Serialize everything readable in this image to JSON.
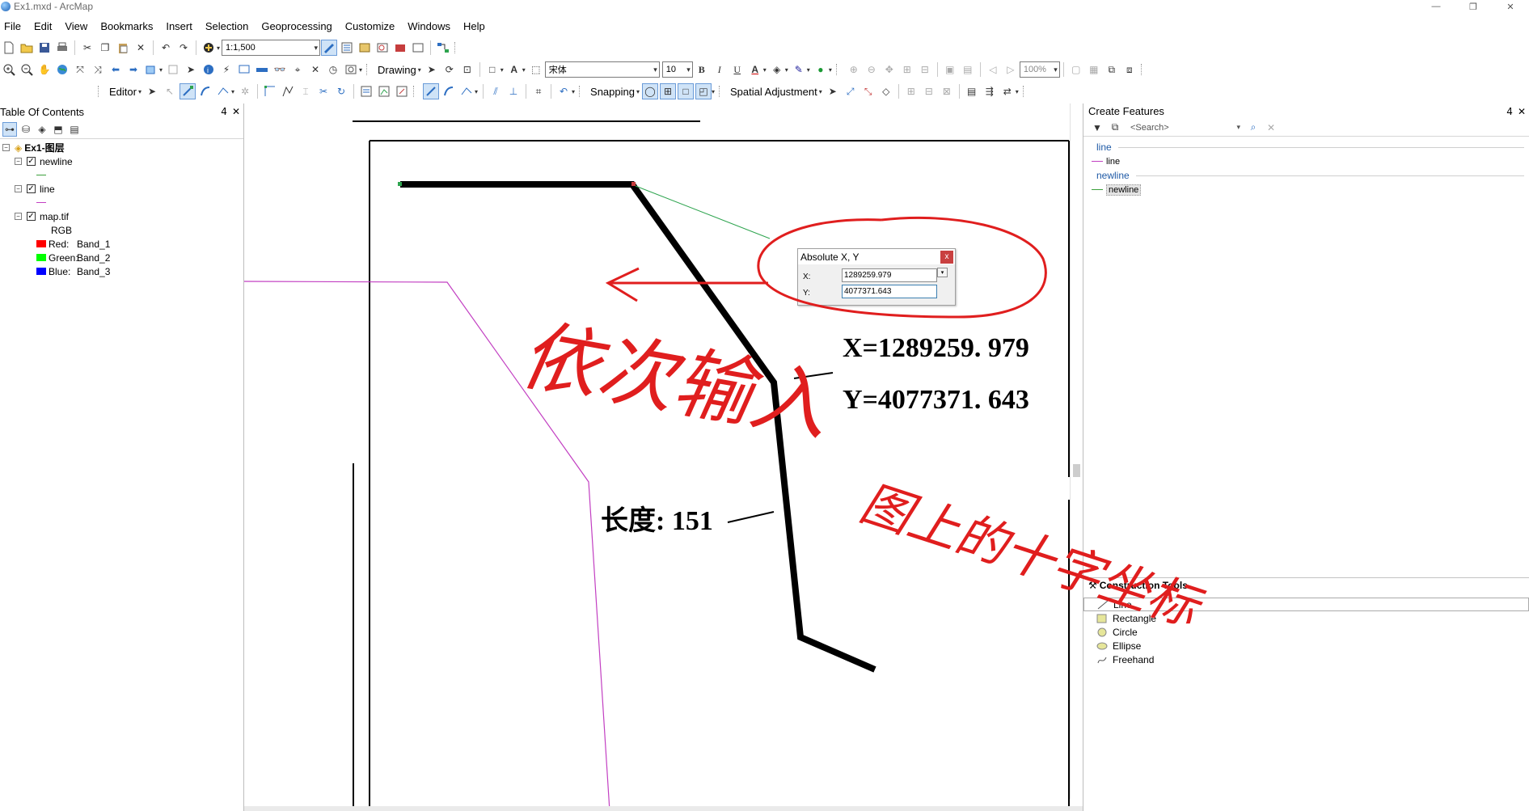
{
  "window": {
    "title": "Ex1.mxd - ArcMap",
    "controls": [
      "—",
      "❐",
      "✕"
    ]
  },
  "menu": [
    "File",
    "Edit",
    "View",
    "Bookmarks",
    "Insert",
    "Selection",
    "Geoprocessing",
    "Customize",
    "Windows",
    "Help"
  ],
  "toolbar": {
    "scale": "1:1,500",
    "drawing_label": "Drawing",
    "font_name": "宋体",
    "font_size": "10",
    "bold": "B",
    "italic": "I",
    "underline": "U",
    "text_color_letter": "A",
    "zoom_percent": "100%",
    "editor_label": "Editor",
    "snapping_label": "Snapping",
    "spatial_adjustment_label": "Spatial Adjustment"
  },
  "toc": {
    "title": "Table Of Contents",
    "pin": "4",
    "close": "✕",
    "root": "Ex1-图层",
    "layers": [
      {
        "name": "newline",
        "checked": true,
        "symbol_color": "#3ca03c"
      },
      {
        "name": "line",
        "checked": true,
        "symbol_color": "#c23fc2"
      },
      {
        "name": "map.tif",
        "checked": true
      }
    ],
    "raster": {
      "composite": "RGB",
      "bands": [
        {
          "channel": "Red:",
          "band": "Band_1",
          "color": "#ff0000"
        },
        {
          "channel": "Green:",
          "band": "Band_2",
          "color": "#00ff00"
        },
        {
          "channel": "Blue:",
          "band": "Band_3",
          "color": "#0000ff"
        }
      ]
    }
  },
  "absolute_xy": {
    "title": "Absolute X, Y",
    "close": "x",
    "x_label": "X:",
    "y_label": "Y:",
    "x_value": "1289259.979",
    "y_value": "4077371.643"
  },
  "map": {
    "label_x": "X=1289259. 979",
    "label_y": "Y=4077371. 643",
    "label_length": "长度: 151"
  },
  "create_features": {
    "title": "Create Features",
    "pin": "4",
    "close": "✕",
    "search_placeholder": "<Search>",
    "groups": [
      {
        "name": "line",
        "items": [
          {
            "label": "line",
            "color": "#c23fc2",
            "selected": false
          }
        ]
      },
      {
        "name": "newline",
        "items": [
          {
            "label": "newline",
            "color": "#3ca03c",
            "selected": true
          }
        ]
      }
    ]
  },
  "construction_tools": {
    "title": "Construction Tools",
    "items": [
      "Line",
      "Rectangle",
      "Circle",
      "Ellipse",
      "Freehand"
    ]
  },
  "annotation": {
    "text_left": "依次输入",
    "text_right": "图上的十字坐标"
  }
}
